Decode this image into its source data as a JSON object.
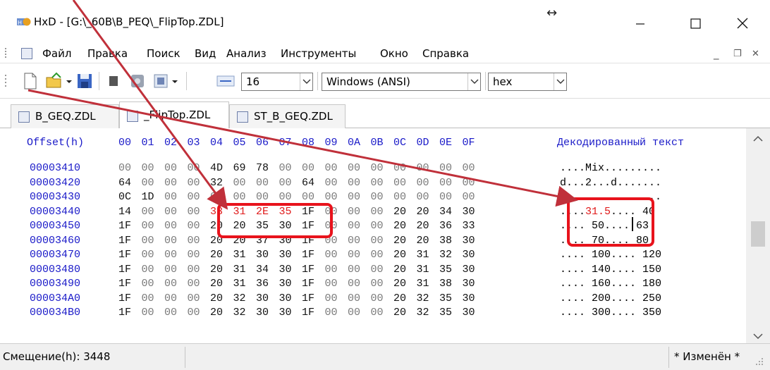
{
  "window": {
    "title": "HxD - [G:\\_60B\\B_PEQ\\_FlipTop.ZDL]",
    "app_icon_label": "HxD",
    "resize_indicator": "↔",
    "minimize_glyph": "—",
    "maximize_glyph": "☐",
    "close_glyph": "✕"
  },
  "menu": {
    "items": [
      "Файл",
      "Правка",
      "Поиск",
      "Вид",
      "Анализ",
      "Инструменты",
      "Окно",
      "Справка"
    ],
    "mdi_controls": [
      "_",
      "❐",
      "✕"
    ]
  },
  "toolbar": {
    "bytes_per_row": "16",
    "charset": "Windows (ANSI)",
    "offset_base": "hex"
  },
  "tabs": [
    {
      "label": "B_GEQ.ZDL",
      "active": false
    },
    {
      "label": "_FlipTop.ZDL",
      "active": true
    },
    {
      "label": "ST_B_GEQ.ZDL",
      "active": false
    }
  ],
  "hex": {
    "header_offset": "Offset(h)",
    "columns": [
      "00",
      "01",
      "02",
      "03",
      "04",
      "05",
      "06",
      "07",
      "08",
      "09",
      "0A",
      "0B",
      "0C",
      "0D",
      "0E",
      "0F"
    ],
    "header_decoded": "Декодированный текст",
    "rows": [
      {
        "offset": "00003410",
        "bytes": [
          "00",
          "00",
          "00",
          "00",
          "4D",
          "69",
          "78",
          "00",
          "00",
          "00",
          "00",
          "00",
          "00",
          "00",
          "00",
          "00"
        ],
        "text": "....Mix........."
      },
      {
        "offset": "00003420",
        "bytes": [
          "64",
          "00",
          "00",
          "00",
          "32",
          "00",
          "00",
          "00",
          "64",
          "00",
          "00",
          "00",
          "00",
          "00",
          "00",
          "00"
        ],
        "text": "d...2...d......."
      },
      {
        "offset": "00003430",
        "bytes": [
          "0C",
          "1D",
          "00",
          "00",
          "00",
          "00",
          "00",
          "00",
          "00",
          "00",
          "00",
          "00",
          "00",
          "00",
          "00",
          "00"
        ],
        "text": "................"
      },
      {
        "offset": "00003440",
        "bytes": [
          "14",
          "00",
          "00",
          "00",
          "33",
          "31",
          "2E",
          "35",
          "1F",
          "00",
          "00",
          "00",
          "20",
          "20",
          "34",
          "30"
        ],
        "text": "....31.5....  40"
      },
      {
        "offset": "00003450",
        "bytes": [
          "1F",
          "00",
          "00",
          "00",
          "20",
          "20",
          "35",
          "30",
          "1F",
          "00",
          "00",
          "00",
          "20",
          "20",
          "36",
          "33"
        ],
        "text": "....  50....  63"
      },
      {
        "offset": "00003460",
        "bytes": [
          "1F",
          "00",
          "00",
          "00",
          "20",
          "20",
          "37",
          "30",
          "1F",
          "00",
          "00",
          "00",
          "20",
          "20",
          "38",
          "30"
        ],
        "text": "....  70....  80"
      },
      {
        "offset": "00003470",
        "bytes": [
          "1F",
          "00",
          "00",
          "00",
          "20",
          "31",
          "30",
          "30",
          "1F",
          "00",
          "00",
          "00",
          "20",
          "31",
          "32",
          "30"
        ],
        "text": ".... 100.... 120"
      },
      {
        "offset": "00003480",
        "bytes": [
          "1F",
          "00",
          "00",
          "00",
          "20",
          "31",
          "34",
          "30",
          "1F",
          "00",
          "00",
          "00",
          "20",
          "31",
          "35",
          "30"
        ],
        "text": ".... 140.... 150"
      },
      {
        "offset": "00003490",
        "bytes": [
          "1F",
          "00",
          "00",
          "00",
          "20",
          "31",
          "36",
          "30",
          "1F",
          "00",
          "00",
          "00",
          "20",
          "31",
          "38",
          "30"
        ],
        "text": ".... 160.... 180"
      },
      {
        "offset": "000034A0",
        "bytes": [
          "1F",
          "00",
          "00",
          "00",
          "20",
          "32",
          "30",
          "30",
          "1F",
          "00",
          "00",
          "00",
          "20",
          "32",
          "35",
          "30"
        ],
        "text": ".... 200.... 250"
      }
    ],
    "partial_row": {
      "offset": "000034B0",
      "bytes": [
        "1F",
        "00",
        "00",
        "00",
        "20",
        "32",
        "30",
        "30",
        "1F",
        "00",
        "00",
        "00",
        "20",
        "32",
        "35",
        "30"
      ],
      "text": ".... 300.... 350"
    },
    "highlight_row": "00003440",
    "highlight_bytes": [
      "33",
      "31",
      "2E",
      "35"
    ],
    "highlight_text": "31.5",
    "highlight_color": "#e01a1a",
    "annotation_color": "#c0303a"
  },
  "status": {
    "offset": "Смещение(h): 3448",
    "modified": "* Изменён *"
  }
}
